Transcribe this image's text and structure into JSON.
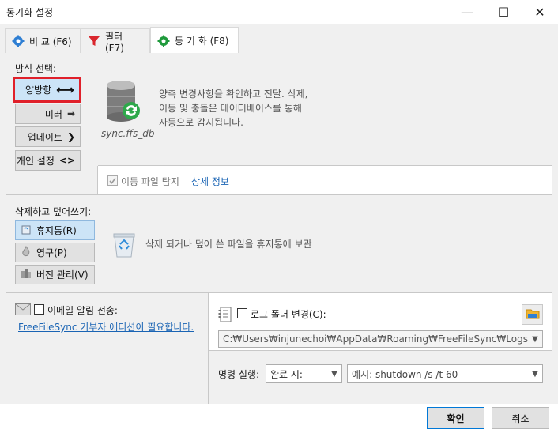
{
  "window": {
    "title": "동기화 설정",
    "minimize": "—",
    "maximize": "☐",
    "close": "✕"
  },
  "tabs": [
    {
      "label": "비 교 (F6)",
      "icon": "gear-blue-icon",
      "active": false
    },
    {
      "label": "필터 (F7)",
      "icon": "funnel-red-icon",
      "active": false
    },
    {
      "label": "동 기 화 (F8)",
      "icon": "gear-green-icon",
      "active": true
    }
  ],
  "method": {
    "section_label": "방식 선택:",
    "buttons": [
      {
        "label": "양방향",
        "symbol": "⟷",
        "selected": true
      },
      {
        "label": "미러",
        "symbol": "➡",
        "selected": false
      },
      {
        "label": "업데이트",
        "symbol": "❯",
        "selected": false
      },
      {
        "label": "개인 설정",
        "symbol": "<>",
        "selected": false
      }
    ],
    "db_file": "sync.ffs_db",
    "description": [
      "양측 변경사항을 확인하고 전달. 삭제,",
      "이동 및 충돌은 데이터베이스를 통해",
      "자동으로 감지됩니다."
    ],
    "detect_moved": "이동 파일 탐지",
    "detect_moved_checked": true,
    "details_link": "상세 정보"
  },
  "deletion": {
    "section_label": "삭제하고 덮어쓰기:",
    "buttons": [
      {
        "label": "휴지통(R)",
        "icon": "recycle-bin-icon",
        "selected": true
      },
      {
        "label": "영구(P)",
        "icon": "flame-icon",
        "selected": false
      },
      {
        "label": "버전 관리(V)",
        "icon": "versioning-icon",
        "selected": false
      }
    ],
    "description": "삭제 되거나 덮어 쓴 파일을 휴지통에 보관"
  },
  "email": {
    "label": "이메일 알림 전송:",
    "checked": false,
    "edition_link": "FreeFileSync 기부자 에디션이 필요합니다."
  },
  "log": {
    "label": "로그 폴더 변경(C):",
    "checked": false,
    "path": "C:₩Users₩injunechoi₩AppData₩Roaming₩FreeFileSync₩Logs"
  },
  "command": {
    "label": "명령 실행:",
    "when": "완료 시:",
    "placeholder": "예시: shutdown /s /t 60"
  },
  "footer": {
    "ok": "확인",
    "cancel": "취소"
  },
  "colors": {
    "accent_blue": "#1a64b4",
    "selected_bg": "#cce4f7",
    "highlight_red": "#e0202a"
  }
}
